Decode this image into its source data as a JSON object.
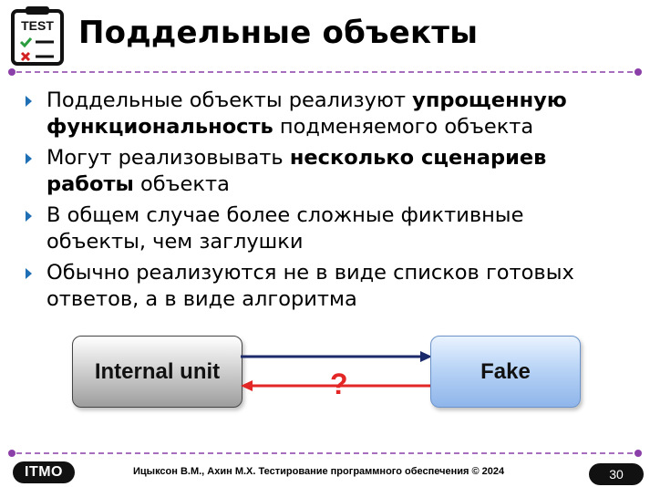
{
  "slide": {
    "icon_text": "TEST",
    "title": "Поддельные объекты",
    "bullets": [
      [
        {
          "text": "Поддельные объекты реализуют ",
          "bold": false
        },
        {
          "text": "упрощенную",
          "bold": true
        },
        {
          "br": true
        },
        {
          "text": "функциональность",
          "bold": true
        },
        {
          "text": " подменяемого объекта",
          "bold": false
        }
      ],
      [
        {
          "text": "Могут реализовывать ",
          "bold": false
        },
        {
          "text": "несколько сценариев",
          "bold": true
        },
        {
          "br": true
        },
        {
          "text": "работы",
          "bold": true
        },
        {
          "text": " объекта",
          "bold": false
        }
      ],
      [
        {
          "text": "В общем случае более сложные фиктивные",
          "bold": false
        },
        {
          "br": true
        },
        {
          "text": "объекты, чем заглушки",
          "bold": false
        }
      ],
      [
        {
          "text": "Обычно реализуются не в виде списков готовых",
          "bold": false
        },
        {
          "br": true
        },
        {
          "text": "ответов, а в виде алгоритма",
          "bold": false
        }
      ]
    ],
    "diagram": {
      "left_box_label": "Internal unit",
      "right_box_label": "Fake",
      "question_mark": "?",
      "forward_arrow_color": "#1b2a6b",
      "return_arrow_color": "#e32626"
    }
  },
  "footer": {
    "logo": "ITMO",
    "text": "Ицыксон В.М., Ахин М.Х. Тестирование программного обеспечения © 2024",
    "page_number": "30"
  },
  "colors": {
    "divider": "#8b3fa8",
    "bullet_arrow": "#1f6fb5",
    "fake_box": "#b9d4f6",
    "internal_box": "#c9c9c9"
  }
}
